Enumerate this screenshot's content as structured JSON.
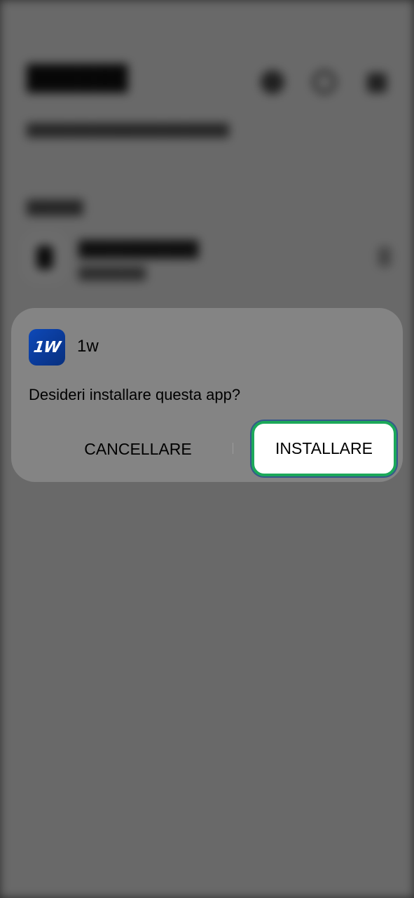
{
  "dialog": {
    "app_icon_text": "1W",
    "app_name": "1w",
    "question": "Desideri installare questa app?",
    "cancel_label": "CANCELLARE",
    "install_label": "INSTALLARE"
  },
  "colors": {
    "install_highlight_border": "#1ca85a",
    "app_icon_blue": "#0a3a98",
    "dialog_background": "#848484",
    "scrim": "#6a6a6a"
  }
}
